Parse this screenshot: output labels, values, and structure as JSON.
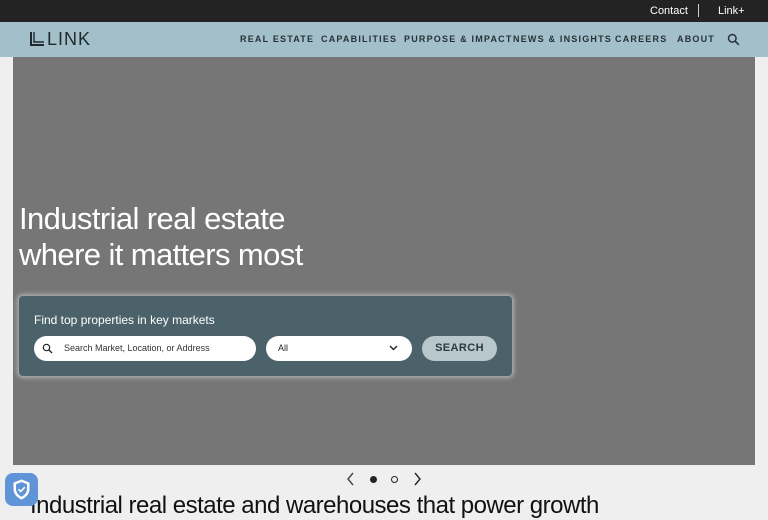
{
  "topbar": {
    "contact": "Contact",
    "linkplus": "Link+"
  },
  "nav": {
    "logo_text": "LINK",
    "items": [
      "REAL ESTATE",
      "CAPABILITIES",
      "PURPOSE & IMPACT",
      "NEWS & INSIGHTS",
      "CAREERS",
      "ABOUT"
    ]
  },
  "hero": {
    "headline_line1": "Industrial real estate",
    "headline_line2": "where it matters most"
  },
  "search_panel": {
    "title": "Find top properties in key markets",
    "placeholder": "Search Market, Location, or Address",
    "select_value": "All",
    "button_label": "SEARCH"
  },
  "carousel": {
    "slide_count": 2,
    "active_index": 0
  },
  "section": {
    "title": "Industrial real estate and warehouses that power growth"
  },
  "colors": {
    "nav_bg": "#a3bfc9",
    "panel_bg": "#4b626b",
    "topbar_bg": "#232323",
    "hero_bg": "#767676"
  }
}
